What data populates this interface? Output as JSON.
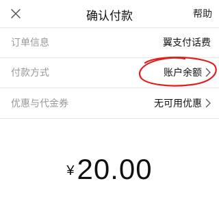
{
  "header": {
    "title": "确认付款",
    "help_label": "帮助"
  },
  "rows": [
    {
      "label": "订单信息",
      "value": "翼支付话费",
      "has_chevron": false
    },
    {
      "label": "付款方式",
      "value": "账户余额",
      "has_chevron": true
    },
    {
      "label": "优惠与代金券",
      "value": "无可用优惠",
      "has_chevron": true
    }
  ],
  "amount": {
    "currency": "¥",
    "value": "20.00"
  },
  "annotation": {
    "color": "#e02020"
  },
  "icons": {
    "close": "close-icon",
    "chevron": "chevron-right-icon"
  }
}
